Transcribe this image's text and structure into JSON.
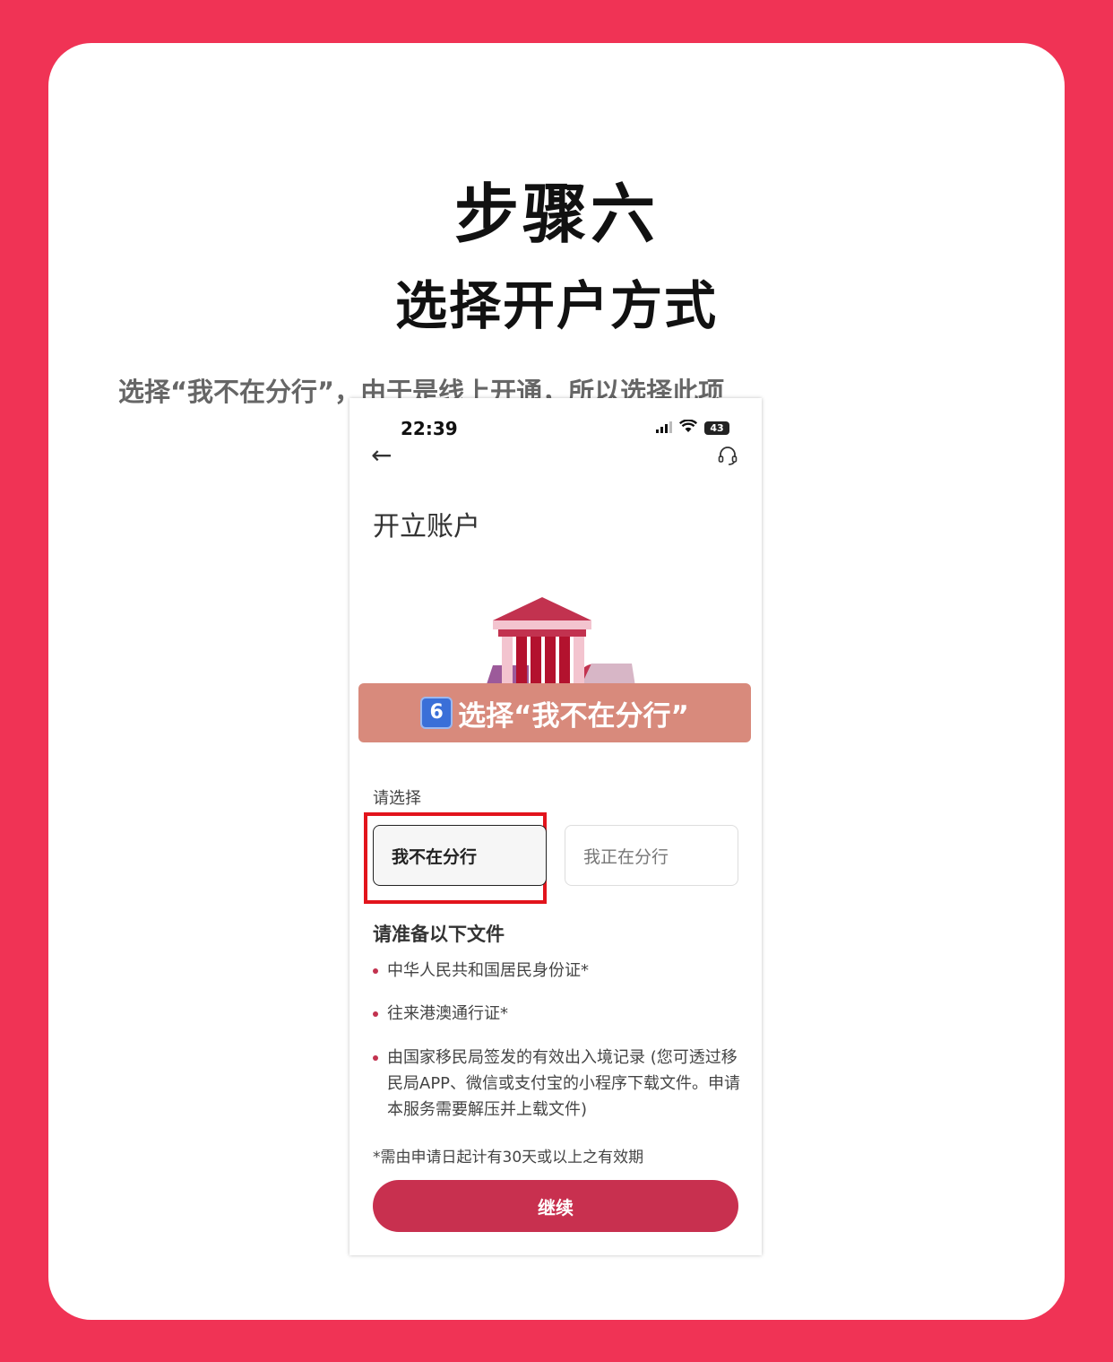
{
  "header": {
    "title": "步骤六",
    "subtitle": "选择开户方式",
    "description": "选择“我不在分行”，由于是线上开通，所以选择此项"
  },
  "phone": {
    "status_time": "22:39",
    "battery": "43",
    "page_title": "开立账户",
    "banner_badge": "6",
    "banner_text": "选择“我不在分行”",
    "select_label": "请选择",
    "options": [
      "我不在分行",
      "我正在分行"
    ],
    "docs_title": "请准备以下文件",
    "documents": [
      "中华人民共和国居民身份证*",
      "往来港澳通行证*",
      "由国家移民局签发的有效出入境记录 (您可透过移民局APP、微信或支付宝的小程序下载文件。申请本服务需要解压并上载文件)"
    ],
    "note": "*需由申请日起计有30天或以上之有效期",
    "continue_label": "继续"
  },
  "colors": {
    "background": "#f03355",
    "accent": "#c8304f",
    "highlight": "#e2141c",
    "banner": "#d88a7c"
  },
  "icons": [
    "back-arrow-icon",
    "headset-icon",
    "signal-icon",
    "wifi-icon",
    "battery-icon",
    "bank-building-icon"
  ]
}
